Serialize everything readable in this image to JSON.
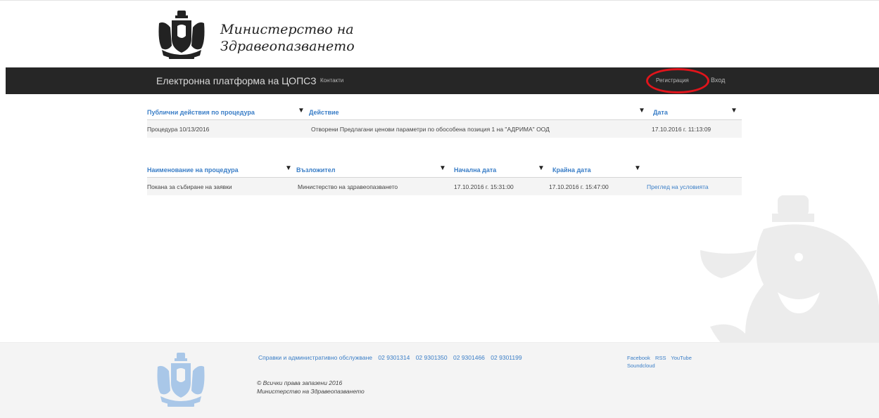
{
  "header": {
    "ministry_line1": "Министерство на",
    "ministry_line2": "Здравеопазването"
  },
  "navbar": {
    "brand": "Електронна платформа на ЦОПСЗ",
    "contacts": "Контакти",
    "register": "Регистрация",
    "login": "Вход"
  },
  "actions_table": {
    "headers": [
      "Публични действия по процедура",
      "Действие",
      "Дата"
    ],
    "rows": [
      {
        "procedure": "Процедура 10/13/2016",
        "action": "Отворени Предлагани ценови параметри по обособена позиция 1 на \"АДРИМА\" ООД",
        "date": "17.10.2016 г. 11:13:09"
      }
    ]
  },
  "procedures_table": {
    "headers": [
      "Наименование на процедура",
      "Възложител",
      "Начална дата",
      "Крайна дата"
    ],
    "rows": [
      {
        "name": "Покана за събиране на заявки",
        "contractor": "Министерство на здравеопазването",
        "start": "17.10.2016 г. 15:31:00",
        "end": "17.10.2016 г. 15:47:00",
        "link": "Преглед на условията"
      }
    ]
  },
  "footer": {
    "help_label": "Справки и административно обслужване",
    "phones": [
      "02 9301314",
      "02 9301350",
      "02 9301466",
      "02 9301199"
    ],
    "copyright_line1": "© Всички права запазени 2016",
    "copyright_line2": "Министерство на Здравеопазването",
    "social": [
      "Facebook",
      "RSS",
      "YouTube",
      "Soundcloud"
    ]
  },
  "colors": {
    "navbar_bg": "#262626",
    "link_blue": "#3a7ec7",
    "highlight_red": "#e1141b",
    "footer_bg": "#f4f4f4"
  }
}
